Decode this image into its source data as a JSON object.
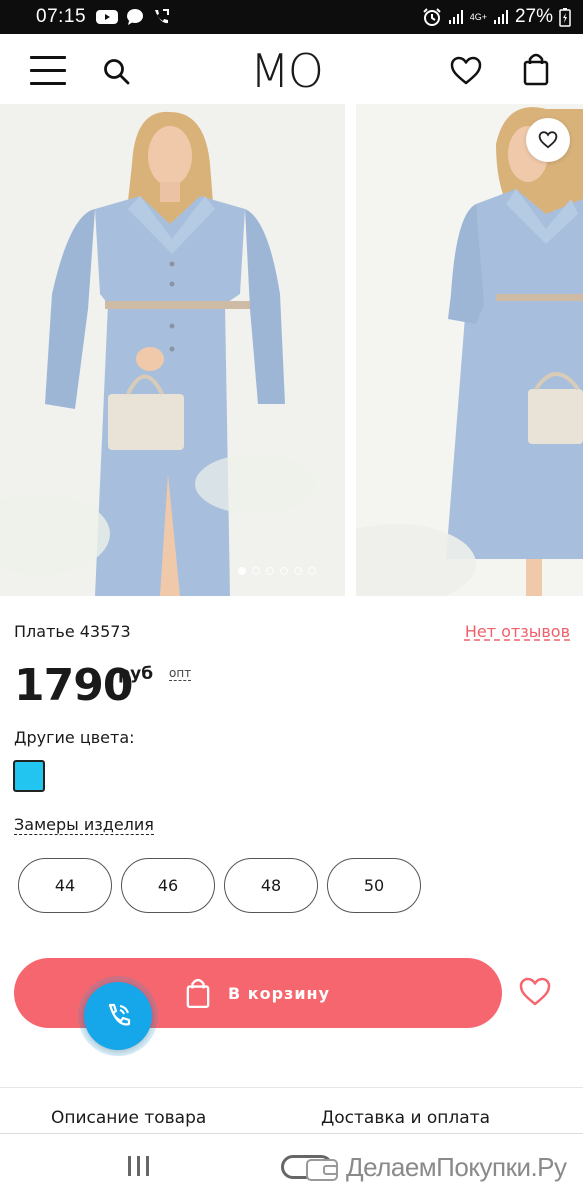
{
  "status_bar": {
    "time": "07:15",
    "network": "4G+",
    "battery": "27%"
  },
  "header": {
    "logo": "MO",
    "icons": [
      "menu-icon",
      "search-icon",
      "heart-icon",
      "shopping-bag-icon"
    ]
  },
  "gallery": {
    "photos": [
      "model-blue-dress-front",
      "model-blue-dress-side"
    ],
    "dots_count": 6,
    "active_dot": 0
  },
  "product": {
    "name": "Платье 43573",
    "reviews_link": "Нет отзывов",
    "price": "1790",
    "currency": "руб",
    "wholesale_label": "опт",
    "other_colors_label": "Другие цвета:",
    "color_swatch": "#22c5ef",
    "measurements_label": "Замеры изделия",
    "sizes": [
      "44",
      "46",
      "48",
      "50"
    ],
    "add_to_cart_label": "В корзину"
  },
  "colors": {
    "accent": "#f6666f",
    "link": "#f0606b",
    "call_fab": "#16a7ea"
  },
  "tabs": {
    "description": "Описание товара",
    "delivery": "Доставка и оплата"
  },
  "watermark": "ДелаемПокупки.Ру"
}
